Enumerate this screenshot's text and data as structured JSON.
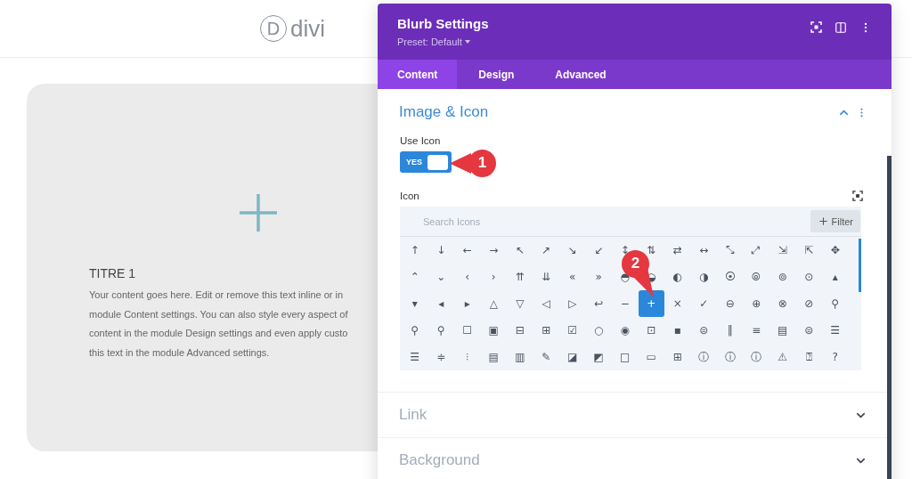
{
  "page": {
    "logo": {
      "mark": "D",
      "text": "divi"
    },
    "card": {
      "title": "TITRE 1",
      "lines": [
        "Your content goes here. Edit or remove this text inline or in",
        "module Content settings. You can also style every aspect of",
        "content in the module Design settings and even apply custo",
        "this text in the module Advanced settings."
      ]
    }
  },
  "panel": {
    "title": "Blurb Settings",
    "preset": "Preset: Default",
    "tabs": [
      {
        "label": "Content",
        "selected": true
      },
      {
        "label": "Design",
        "selected": false
      },
      {
        "label": "Advanced",
        "selected": false
      }
    ],
    "sections": [
      {
        "title": "Image & Icon",
        "expanded": true
      },
      {
        "title": "Link",
        "expanded": false
      },
      {
        "title": "Background",
        "expanded": false
      }
    ],
    "use_icon": {
      "label": "Use Icon",
      "toggle": {
        "label": "YES",
        "on": true
      }
    },
    "icon_field": {
      "label": "Icon",
      "search": {
        "placeholder": "Search Icons"
      },
      "filter": "Filter",
      "icons": [
        {
          "glyph": "↑",
          "selected": false
        },
        {
          "glyph": "↓",
          "selected": false
        },
        {
          "glyph": "←",
          "selected": false
        },
        {
          "glyph": "→",
          "selected": false
        },
        {
          "glyph": "↖",
          "selected": false
        },
        {
          "glyph": "↗",
          "selected": false
        },
        {
          "glyph": "↘",
          "selected": false
        },
        {
          "glyph": "↙",
          "selected": false
        },
        {
          "glyph": "↕",
          "selected": false
        },
        {
          "glyph": "⇅",
          "selected": false
        },
        {
          "glyph": "⇄",
          "selected": false
        },
        {
          "glyph": "↔",
          "selected": false
        },
        {
          "glyph": "⤡",
          "selected": false
        },
        {
          "glyph": "⤢",
          "selected": false
        },
        {
          "glyph": "⇲",
          "selected": false
        },
        {
          "glyph": "⇱",
          "selected": false
        },
        {
          "glyph": "✥",
          "selected": false
        },
        {
          "glyph": "⌃",
          "selected": false
        },
        {
          "glyph": "⌄",
          "selected": false
        },
        {
          "glyph": "‹",
          "selected": false
        },
        {
          "glyph": "›",
          "selected": false
        },
        {
          "glyph": "⇈",
          "selected": false
        },
        {
          "glyph": "⇊",
          "selected": false
        },
        {
          "glyph": "«",
          "selected": false
        },
        {
          "glyph": "»",
          "selected": false
        },
        {
          "glyph": "◓",
          "selected": false
        },
        {
          "glyph": "◒",
          "selected": false
        },
        {
          "glyph": "◐",
          "selected": false
        },
        {
          "glyph": "◑",
          "selected": false
        },
        {
          "glyph": "⦿",
          "selected": false
        },
        {
          "glyph": "⦾",
          "selected": false
        },
        {
          "glyph": "⊚",
          "selected": false
        },
        {
          "glyph": "⊙",
          "selected": false
        },
        {
          "glyph": "▴",
          "selected": false
        },
        {
          "glyph": "▾",
          "selected": false
        },
        {
          "glyph": "◂",
          "selected": false
        },
        {
          "glyph": "▸",
          "selected": false
        },
        {
          "glyph": "△",
          "selected": false
        },
        {
          "glyph": "▽",
          "selected": false
        },
        {
          "glyph": "◁",
          "selected": false
        },
        {
          "glyph": "▷",
          "selected": false
        },
        {
          "glyph": "↩",
          "selected": false
        },
        {
          "glyph": "−",
          "selected": false
        },
        {
          "glyph": "+",
          "selected": true
        },
        {
          "glyph": "×",
          "selected": false
        },
        {
          "glyph": "✓",
          "selected": false
        },
        {
          "glyph": "⊖",
          "selected": false
        },
        {
          "glyph": "⊕",
          "selected": false
        },
        {
          "glyph": "⊗",
          "selected": false
        },
        {
          "glyph": "⊘",
          "selected": false
        },
        {
          "glyph": "⚲",
          "selected": false
        },
        {
          "glyph": "⚲",
          "selected": false
        },
        {
          "glyph": "⚲",
          "selected": false
        },
        {
          "glyph": "☐",
          "selected": false
        },
        {
          "glyph": "▣",
          "selected": false
        },
        {
          "glyph": "⊟",
          "selected": false
        },
        {
          "glyph": "⊞",
          "selected": false
        },
        {
          "glyph": "☑",
          "selected": false
        },
        {
          "glyph": "○",
          "selected": false
        },
        {
          "glyph": "◉",
          "selected": false
        },
        {
          "glyph": "⊡",
          "selected": false
        },
        {
          "glyph": "▪",
          "selected": false
        },
        {
          "glyph": "⊜",
          "selected": false
        },
        {
          "glyph": "‖",
          "selected": false
        },
        {
          "glyph": "≡",
          "selected": false
        },
        {
          "glyph": "▤",
          "selected": false
        },
        {
          "glyph": "⊜",
          "selected": false
        },
        {
          "glyph": "☰",
          "selected": false
        },
        {
          "glyph": "☰",
          "selected": false
        },
        {
          "glyph": "≑",
          "selected": false
        },
        {
          "glyph": "⫶",
          "selected": false
        },
        {
          "glyph": "▤",
          "selected": false
        },
        {
          "glyph": "▥",
          "selected": false
        },
        {
          "glyph": "✎",
          "selected": false
        },
        {
          "glyph": "◪",
          "selected": false
        },
        {
          "glyph": "◩",
          "selected": false
        },
        {
          "glyph": "□",
          "selected": false
        },
        {
          "glyph": "▭",
          "selected": false
        },
        {
          "glyph": "⊞",
          "selected": false
        },
        {
          "glyph": "ⓘ",
          "selected": false
        },
        {
          "glyph": "ⓘ",
          "selected": false
        },
        {
          "glyph": "ⓘ",
          "selected": false
        },
        {
          "glyph": "⚠",
          "selected": false
        },
        {
          "glyph": "⍰",
          "selected": false
        },
        {
          "glyph": "?",
          "selected": false
        }
      ]
    }
  },
  "callouts": [
    {
      "number": "1"
    },
    {
      "number": "2"
    }
  ]
}
